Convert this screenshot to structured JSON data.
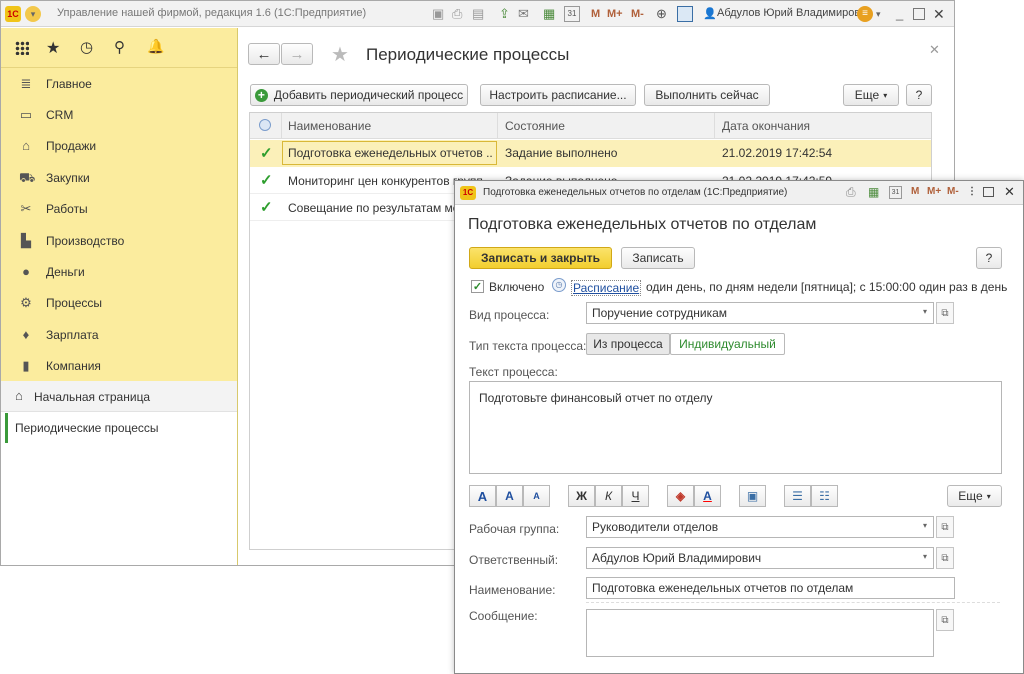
{
  "titlebar": {
    "app_title": "Управление нашей фирмой, редакция 1.6  (1С:Предприятие)",
    "user": "Абдулов Юрий Владимирович"
  },
  "sidebar": {
    "items": [
      {
        "label": "Главное",
        "icon": "list-icon"
      },
      {
        "label": "CRM",
        "icon": "crm-icon"
      },
      {
        "label": "Продажи",
        "icon": "basket-icon"
      },
      {
        "label": "Закупки",
        "icon": "cart-icon"
      },
      {
        "label": "Работы",
        "icon": "tools-icon"
      },
      {
        "label": "Производство",
        "icon": "factory-icon"
      },
      {
        "label": "Деньги",
        "icon": "money-icon"
      },
      {
        "label": "Процессы",
        "icon": "processes-icon"
      },
      {
        "label": "Зарплата",
        "icon": "salary-icon"
      },
      {
        "label": "Компания",
        "icon": "company-icon"
      }
    ],
    "home_label": "Начальная страница",
    "open_page": "Периодические процессы"
  },
  "content": {
    "title": "Периодические процессы",
    "add_button": "Добавить периодический процесс",
    "schedule_button": "Настроить расписание...",
    "run_button": "Выполнить сейчас",
    "more_button": "Еще",
    "help_button": "?",
    "columns": [
      "Наименование",
      "Состояние",
      "Дата окончания"
    ],
    "rows": [
      {
        "name": "Подготовка еженедельных отчетов ...",
        "status": "Задание выполнено",
        "date": "21.02.2019 17:42:54"
      },
      {
        "name": "Мониторинг цен конкурентов групп...",
        "status": "Задание выполнено",
        "date": "21.02.2019 17:42:59"
      },
      {
        "name": "Совещание по результатам ме...",
        "status": "",
        "date": ""
      }
    ]
  },
  "dialog": {
    "window_title": "Подготовка еженедельных отчетов по отделам  (1С:Предприятие)",
    "heading": "Подготовка еженедельных отчетов по отделам",
    "save_close": "Записать и закрыть",
    "save": "Записать",
    "help": "?",
    "enabled_label": "Включено",
    "schedule_link": "Расписание",
    "schedule_text": "один день, по дням недели [пятница]; с 15:00:00 один раз в день",
    "process_type_label": "Вид процесса:",
    "process_type_value": "Поручение сотрудникам",
    "text_type_label": "Тип текста процесса:",
    "text_type_options": [
      "Из процесса",
      "Индивидуальный"
    ],
    "process_text_label": "Текст процесса:",
    "process_text": "Подготовьте финансовый отчет по отделу",
    "fmt_buttons": [
      "A",
      "A",
      "A",
      "Ж",
      "К",
      "Ч",
      "A"
    ],
    "more": "Еще",
    "work_group_label": "Рабочая группа:",
    "work_group_value": "Руководители отделов",
    "responsible_label": "Ответственный:",
    "responsible_value": "Абдулов Юрий Владимирович",
    "name_label": "Наименование:",
    "name_value": "Подготовка еженедельных отчетов по отделам",
    "message_label": "Сообщение:"
  }
}
